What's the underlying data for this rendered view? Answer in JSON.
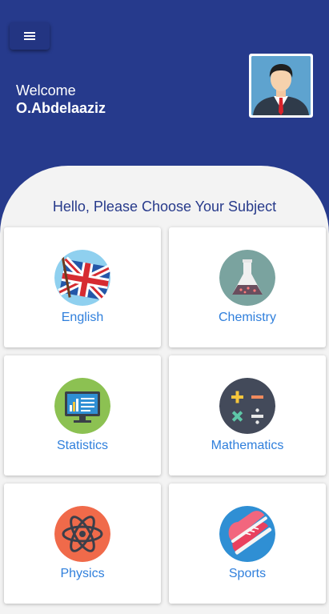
{
  "header": {
    "menu_icon": "hamburger-menu-icon",
    "welcome_text": "Welcome",
    "user_name": "O.Abdelaaziz",
    "avatar_icon": "businessman-avatar"
  },
  "main": {
    "prompt": "Hello, Please Choose Your Subject",
    "subjects": [
      {
        "label": "English",
        "icon": "uk-flag-icon"
      },
      {
        "label": "Chemistry",
        "icon": "flask-icon"
      },
      {
        "label": "Statistics",
        "icon": "monitor-chart-icon"
      },
      {
        "label": "Mathematics",
        "icon": "math-operators-icon"
      },
      {
        "label": "Physics",
        "icon": "atom-icon"
      },
      {
        "label": "Sports",
        "icon": "sneakers-icon"
      }
    ]
  },
  "colors": {
    "header_bg": "#263a8c",
    "panel_bg": "#f3f3f3",
    "accent_text": "#2f7fdc",
    "title_text": "#273a8b"
  }
}
